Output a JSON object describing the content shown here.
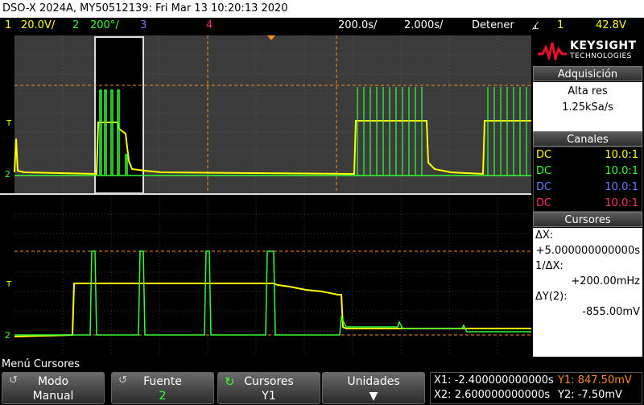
{
  "title": "DSO-X 2024A, MY50512139: Fri Mar 13 10:20:13 2020",
  "status": {
    "ch1_num": "1",
    "ch1_scale": "20.0V/",
    "ch2_num": "2",
    "ch2_scale": "200°/",
    "ch3_num": "3",
    "ch4_num": "4",
    "timebase_pos": "200.0s/",
    "timebase_scale": "2.000s/",
    "run_state": "Detener",
    "trigger_icon": "trigger-edge-icon",
    "trigger_ch": "1",
    "trigger_level": "42.8V"
  },
  "waveform": {
    "ch1_marker": "1",
    "ch2_marker": "2",
    "trigger_marker": "T"
  },
  "brand": {
    "name": "KEYSIGHT",
    "sub": "TECHNOLOGIES"
  },
  "acquisition": {
    "header": "Adquisición",
    "mode": "Alta res",
    "rate": "1.25kSa/s"
  },
  "channels": {
    "header": "Canales",
    "rows": [
      {
        "coupling": "DC",
        "probe": "10.0:1",
        "color": "#ffff00"
      },
      {
        "coupling": "DC",
        "probe": "10.0:1",
        "color": "#33ff33"
      },
      {
        "coupling": "DC",
        "probe": "10.0:1",
        "color": "#6b7bff"
      },
      {
        "coupling": "DC",
        "probe": "10.0:1",
        "color": "#ff2d6e"
      }
    ]
  },
  "cursors": {
    "header": "Cursores",
    "dx_label": "ΔX:",
    "dx_value": "+5.000000000000s",
    "inv_dx_label": "1/ΔX:",
    "inv_dx_value": "+200.00mHz",
    "dy_label": "ΔY(2):",
    "dy_value": "-855.00mV"
  },
  "menu": {
    "label": "Menú Cursores",
    "softkeys": [
      {
        "top": "Modo",
        "bottom": "Manual"
      },
      {
        "top": "Fuente",
        "bottom": "2"
      },
      {
        "top": "Cursores",
        "bottom": "Y1"
      },
      {
        "top": "Unidades",
        "bottom": ""
      }
    ],
    "readout": {
      "x1": "X1: -2.400000000000s",
      "x2": "X2: 2.600000000000s",
      "y1": "Y1: 847.50mV",
      "y2": "Y2: -7.50mV"
    }
  },
  "colors": {
    "ch1": "#ffff00",
    "ch2": "#33ff33",
    "ch3": "#6b7bff",
    "ch4": "#ff2d6e",
    "cursor": "#ff8c1a"
  }
}
